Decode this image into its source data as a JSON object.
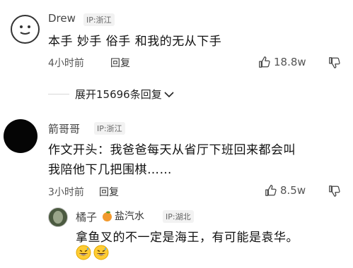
{
  "comments": [
    {
      "user": "Drew",
      "ip": "IP:浙江",
      "text": "本手 妙手 俗手 和我的无从下手",
      "time": "4小时前",
      "reply_label": "回复",
      "likes": "18.8w"
    },
    {
      "user": "箭哥哥",
      "ip": "IP:浙江",
      "text_line1": "作文开头：我爸爸每天从省厅下班回来都会叫",
      "text_line2": "我陪他下几把围棋……",
      "time": "3小时前",
      "reply_label": "回复",
      "likes": "8.5w"
    }
  ],
  "expand_replies": "展开15696条回复",
  "sub_reply": {
    "user": "橘子",
    "badge_text": "盐汽水",
    "ip": "IP:湖北",
    "text": "拿鱼叉的不一定是海王，有可能是袁华。",
    "emoji": "grinning-sweat-emoji"
  }
}
